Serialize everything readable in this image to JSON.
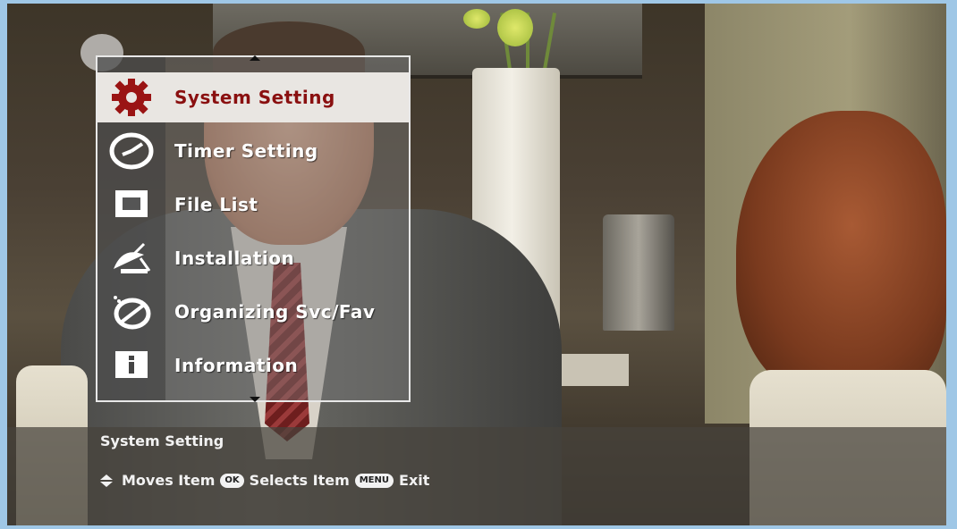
{
  "menu": {
    "items": [
      {
        "label": "System Setting",
        "icon": "gear-icon",
        "selected": true
      },
      {
        "label": "Timer Setting",
        "icon": "clock-icon",
        "selected": false
      },
      {
        "label": "File List",
        "icon": "file-list-icon",
        "selected": false
      },
      {
        "label": "Installation",
        "icon": "satellite-dish-icon",
        "selected": false
      },
      {
        "label": "Organizing Svc/Fav",
        "icon": "organize-icon",
        "selected": false
      },
      {
        "label": "Information",
        "icon": "info-icon",
        "selected": false
      }
    ]
  },
  "info": {
    "title": "System Setting",
    "help": {
      "moves": "Moves Item",
      "ok_key": "OK",
      "selects": "Selects Item",
      "menu_key": "MENU",
      "exit": "Exit"
    }
  },
  "colors": {
    "selected_text": "#8a1010",
    "selected_bg": "#e9e6e2",
    "text": "#ffffff"
  }
}
